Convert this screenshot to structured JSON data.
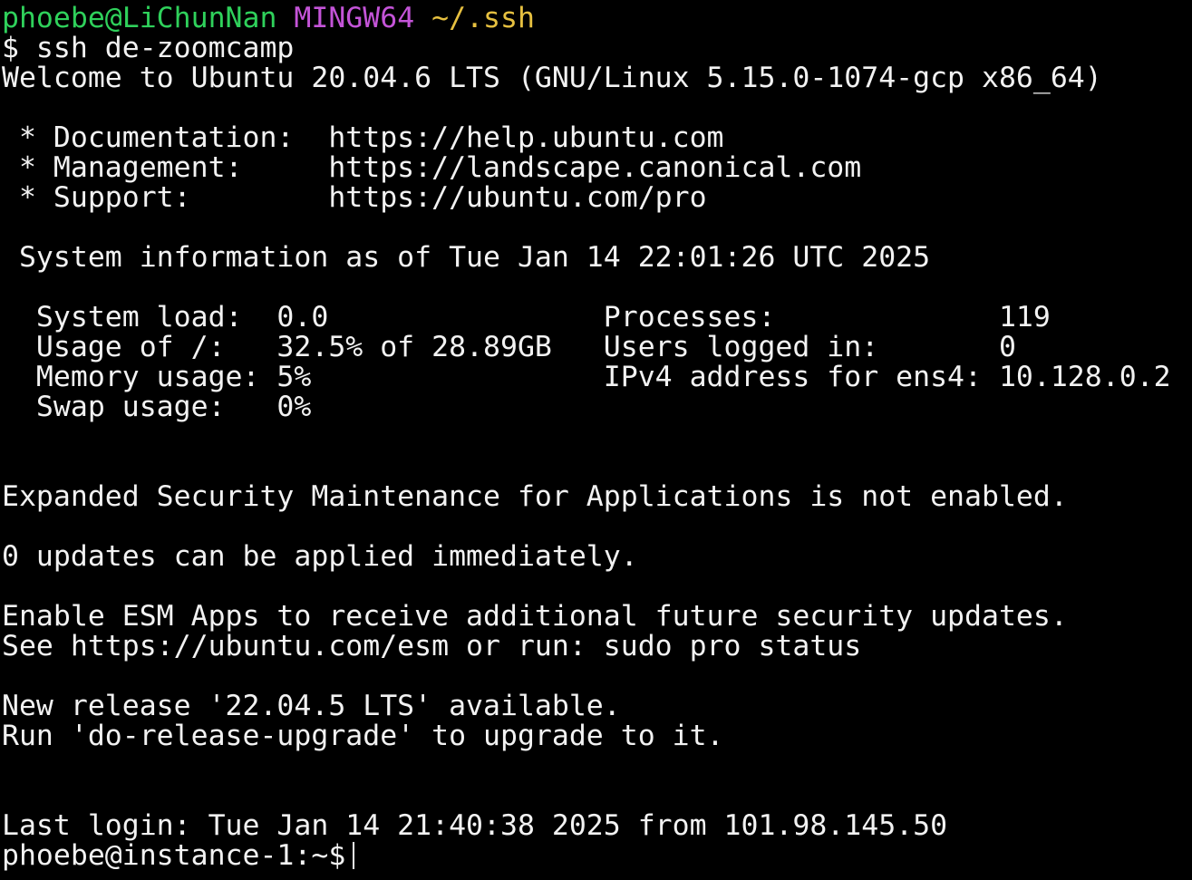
{
  "terminal": {
    "prompt": {
      "user_host": "phoebe@LiChunNan",
      "env": "MINGW64",
      "path": "~/.ssh"
    },
    "command_line": "$ ssh de-zoomcamp",
    "welcome": "Welcome to Ubuntu 20.04.6 LTS (GNU/Linux 5.15.0-1074-gcp x86_64)",
    "links": {
      "documentation": " * Documentation:  https://help.ubuntu.com",
      "management": " * Management:     https://landscape.canonical.com",
      "support": " * Support:        https://ubuntu.com/pro"
    },
    "sysinfo_header": " System information as of Tue Jan 14 22:01:26 UTC 2025",
    "sysinfo": {
      "row1": "  System load:  0.0                Processes:             119",
      "row2": "  Usage of /:   32.5% of 28.89GB   Users logged in:       0",
      "row3": "  Memory usage: 5%                 IPv4 address for ens4: 10.128.0.2",
      "row4": "  Swap usage:   0%"
    },
    "esm_notice": "Expanded Security Maintenance for Applications is not enabled.",
    "updates_notice": "0 updates can be applied immediately.",
    "esm_enable": "Enable ESM Apps to receive additional future security updates.",
    "esm_see": "See https://ubuntu.com/esm or run: sudo pro status",
    "new_release": "New release '22.04.5 LTS' available.",
    "upgrade_hint": "Run 'do-release-upgrade' to upgrade to it.",
    "last_login": "Last login: Tue Jan 14 21:40:38 2025 from 101.98.145.50",
    "remote_prompt": "phoebe@instance-1:~$"
  }
}
